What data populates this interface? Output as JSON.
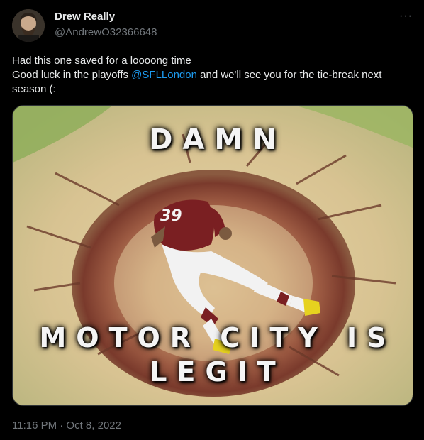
{
  "author": {
    "display_name": "Drew Really",
    "handle": "@AndrewO32366648"
  },
  "post": {
    "line1": "Had this one saved for a loooong time",
    "line2_prefix": "Good luck in the playoffs ",
    "mention": "@SFLLondon",
    "line2_suffix": "  and we'll see you for the tie-break next season (:",
    "timestamp": "11:16 PM · Oct 8, 2022"
  },
  "more_label": "···",
  "meme": {
    "top_text": "DAMN",
    "bottom_line1": "MOTOR CITY IS",
    "bottom_line2": "LEGIT",
    "jersey_number": "39"
  },
  "colors": {
    "background": "#000000",
    "text": "#e7e9ea",
    "muted": "#71767b",
    "link": "#1d9bf0"
  }
}
